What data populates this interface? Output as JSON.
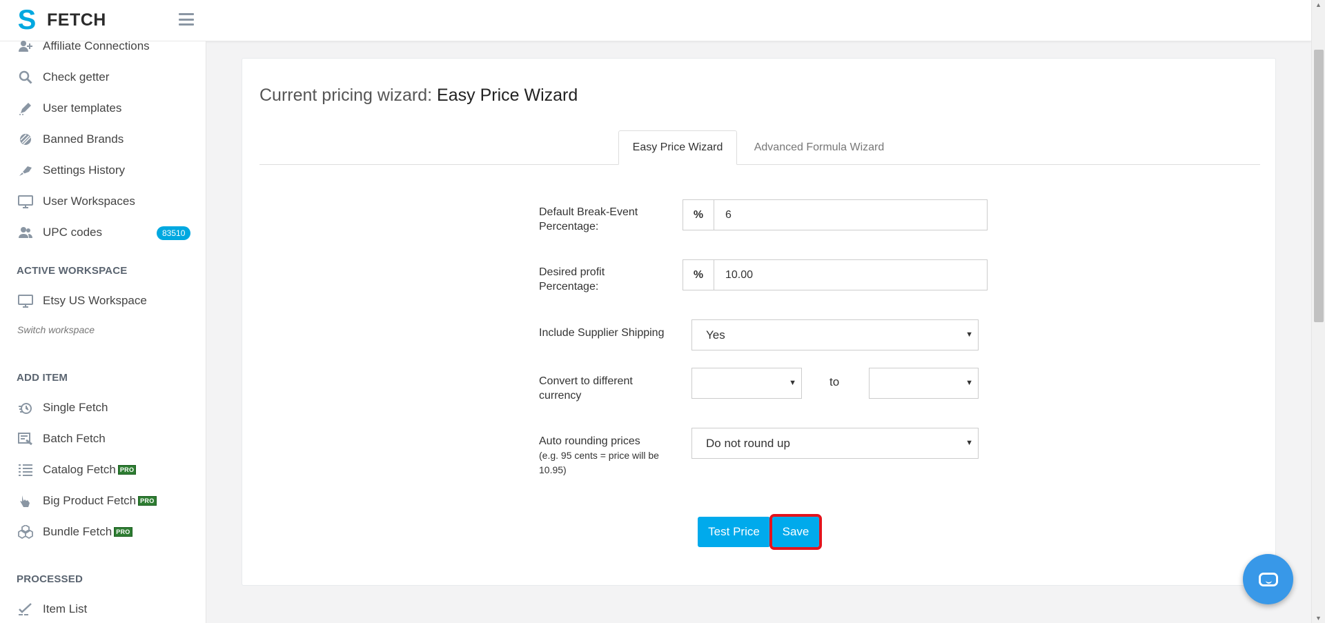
{
  "app": {
    "logo_text": "FETCH",
    "logo_glyph": "S"
  },
  "sidebar": {
    "items": [
      {
        "label": "Affiliate Connections",
        "icon": "user-plus-icon"
      },
      {
        "label": "Check getter",
        "icon": "search-icon"
      },
      {
        "label": "User templates",
        "icon": "edit-icon"
      },
      {
        "label": "Banned Brands",
        "icon": "ban-icon"
      },
      {
        "label": "Settings History",
        "icon": "history-icon"
      },
      {
        "label": "User Workspaces",
        "icon": "monitor-icon"
      },
      {
        "label": "UPC codes",
        "icon": "users-icon",
        "badge": "83510"
      }
    ],
    "active_workspace": {
      "heading": "ACTIVE WORKSPACE",
      "item": {
        "label": "Etsy US Workspace",
        "icon": "monitor-icon"
      },
      "switch_label": "Switch workspace"
    },
    "add_item": {
      "heading": "ADD ITEM",
      "items": [
        {
          "label": "Single Fetch",
          "icon": "single-fetch-icon"
        },
        {
          "label": "Batch Fetch",
          "icon": "batch-fetch-icon"
        },
        {
          "label": "Catalog Fetch",
          "icon": "list-icon",
          "pro": "PRO"
        },
        {
          "label": "Big Product Fetch",
          "icon": "hand-pointer-icon",
          "pro": "PRO"
        },
        {
          "label": "Bundle Fetch",
          "icon": "cubes-icon",
          "pro": "PRO"
        }
      ]
    },
    "processed": {
      "heading": "PROCESSED",
      "items": [
        {
          "label": "Item List",
          "icon": "checklist-icon"
        }
      ]
    }
  },
  "main": {
    "title_prefix": "Current pricing wizard:",
    "title_value": "Easy Price Wizard",
    "tabs": [
      {
        "label": "Easy Price Wizard",
        "active": true
      },
      {
        "label": "Advanced Formula Wizard",
        "active": false
      }
    ],
    "form": {
      "break_even": {
        "label_line1": "Default Break-Event",
        "label_line2": "Percentage:",
        "addon": "%",
        "value": "6"
      },
      "profit": {
        "label_line1": "Desired profit",
        "label_line2": "Percentage:",
        "addon": "%",
        "value": "10.00"
      },
      "shipping": {
        "label": "Include Supplier Shipping",
        "value": "Yes"
      },
      "currency": {
        "label_line1": "Convert to different",
        "label_line2": "currency",
        "from_value": "",
        "to_label": "to",
        "to_value": ""
      },
      "rounding": {
        "label": "Auto rounding prices",
        "hint_line1": "(e.g. 95 cents = price will be",
        "hint_line2": "10.95)",
        "value": "Do not round up"
      }
    },
    "buttons": {
      "test_price": "Test Price",
      "save": "Save"
    }
  },
  "colors": {
    "accent": "#00aaec",
    "highlight_outline": "#e3141d",
    "pro_badge": "#2e7d32"
  }
}
